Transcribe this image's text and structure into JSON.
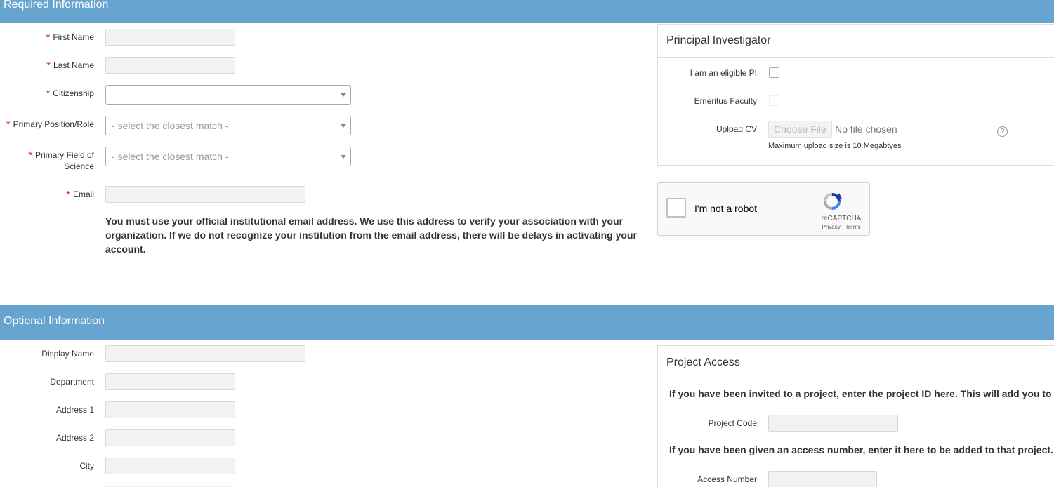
{
  "required_section": {
    "title": "Required Information",
    "first_name_label": "First Name",
    "last_name_label": "Last Name",
    "citizenship_label": "Citizenship",
    "citizenship_value": "",
    "primary_position_label": "Primary Position/Role",
    "primary_position_placeholder": "- select the closest match -",
    "primary_field_label_line1": "Primary Field of",
    "primary_field_label_line2": "Science",
    "primary_field_placeholder": "- select the closest match -",
    "email_label": "Email",
    "email_notice": "You must use your official institutional email address. We use this address to verify your association with your organization. If we do not recognize your institution from the email address, there will be delays in activating your account.",
    "required_marker": "*"
  },
  "pi_panel": {
    "title": "Principal Investigator",
    "eligible_pi_label": "I am an eligible PI",
    "emeritus_label": "Emeritus Faculty",
    "upload_cv_label": "Upload CV",
    "choose_file_label": "Choose File",
    "no_file_text": "No file chosen",
    "help_icon_glyph": "?",
    "max_upload_text": "Maximum upload size is 10 Megabtyes"
  },
  "recaptcha": {
    "label": "I'm not a robot",
    "brand": "reCAPTCHA",
    "links": "Privacy - Terms"
  },
  "optional_section": {
    "title": "Optional Information",
    "display_name_label": "Display Name",
    "department_label": "Department",
    "address1_label": "Address 1",
    "address2_label": "Address 2",
    "city_label": "City"
  },
  "project_panel": {
    "title": "Project Access",
    "invite_text": "If you have been invited to a project, enter the project ID here. This will add you to",
    "project_code_label": "Project Code",
    "access_text": "If you have been given an access number, enter it here to be added to that project.",
    "access_number_label": "Access Number"
  },
  "colors": {
    "section_bar": "#67a4d0",
    "required_star": "#d9281f",
    "input_bg": "#f2f2f2"
  }
}
